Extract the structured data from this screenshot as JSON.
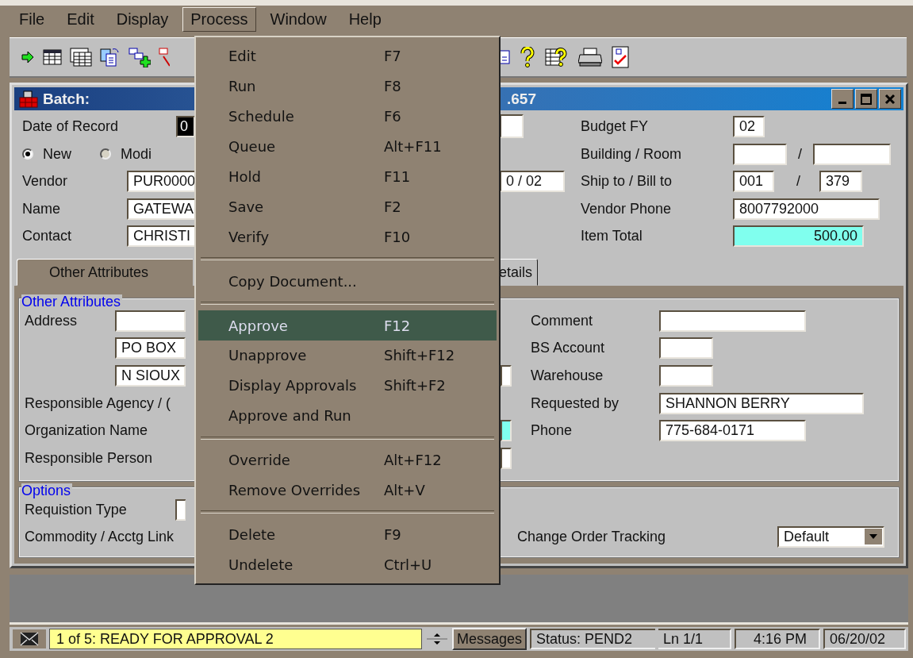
{
  "menu_bar": [
    {
      "label": "File",
      "selected": false
    },
    {
      "label": "Edit",
      "selected": false
    },
    {
      "label": "Display",
      "selected": false
    },
    {
      "label": "Process",
      "selected": true
    },
    {
      "label": "Window",
      "selected": false
    },
    {
      "label": "Help",
      "selected": false
    }
  ],
  "process_menu": {
    "sections": [
      {
        "items": [
          {
            "label": "Edit",
            "shortcut": "F7",
            "selected": false
          },
          {
            "label": "Run",
            "shortcut": "F8",
            "selected": false
          },
          {
            "label": "Schedule",
            "shortcut": "F6",
            "selected": false
          },
          {
            "label": "Queue",
            "shortcut": "Alt+F11",
            "selected": false
          },
          {
            "label": "Hold",
            "shortcut": "F11",
            "selected": false
          },
          {
            "label": "Save",
            "shortcut": "F2",
            "selected": false
          },
          {
            "label": "Verify",
            "shortcut": "F10",
            "selected": false
          }
        ]
      },
      {
        "items": [
          {
            "label": "Copy Document...",
            "selected": false
          }
        ]
      },
      {
        "items": [
          {
            "label": "Approve",
            "shortcut": "F12",
            "selected": true
          },
          {
            "label": "Unapprove",
            "shortcut": "Shift+F12",
            "selected": false
          },
          {
            "label": "Display Approvals",
            "shortcut": "Shift+F2",
            "selected": false
          },
          {
            "label": "Approve and Run",
            "selected": false
          }
        ]
      },
      {
        "items": [
          {
            "label": "Override",
            "shortcut": "Alt+F12",
            "selected": false
          },
          {
            "label": "Remove Overrides",
            "shortcut": "Alt+V",
            "selected": false
          }
        ]
      },
      {
        "items": [
          {
            "label": "Delete",
            "shortcut": "F9",
            "selected": false
          },
          {
            "label": "Undelete",
            "shortcut": "Ctrl+U",
            "selected": false
          }
        ]
      }
    ]
  },
  "window": {
    "title": "Batch:",
    "title_tail": ".657"
  },
  "header": {
    "date_of_record": {
      "label": "Date of Record",
      "value": "0"
    },
    "radios": [
      {
        "label": "New",
        "selected": true
      },
      {
        "label": "Modi",
        "selected": false
      }
    ],
    "left_fields": [
      {
        "label": "Vendor",
        "value": "PUR0000"
      },
      {
        "label": "Name",
        "value": "GATEWA"
      },
      {
        "label": "Contact",
        "value": "CHRISTI"
      }
    ],
    "middle_value": "0  / 02",
    "right_fields": [
      {
        "label": "Budget FY",
        "kind": "single",
        "values": [
          "02"
        ]
      },
      {
        "label": "Building / Room",
        "kind": "pair",
        "separator": "/"
      },
      {
        "label": "Ship to / Bill to",
        "kind": "pair",
        "separator": "/",
        "values": [
          "001",
          "379"
        ]
      },
      {
        "label": "Vendor Phone",
        "kind": "single",
        "values": [
          "8007792000"
        ]
      },
      {
        "label": "Item Total",
        "kind": "computed",
        "values": [
          "500.00"
        ]
      }
    ]
  },
  "tabs": [
    {
      "label": "Other Attributes",
      "selected": true
    },
    {
      "label": "etails",
      "selected": false
    }
  ],
  "other_attributes": {
    "title": "Other Attributes",
    "address": {
      "label": "Address",
      "lines": [
        "PO BOX",
        "N SIOUX"
      ]
    },
    "left_labels": [
      "Responsible Agency / (",
      "Organization Name",
      "Responsible Person"
    ],
    "right_fields": [
      {
        "label": "Comment"
      },
      {
        "label": "BS Account"
      },
      {
        "label": "Warehouse"
      },
      {
        "label": "Requested by",
        "value": "SHANNON BERRY"
      },
      {
        "label": "Phone",
        "value": "775-684-0171"
      }
    ]
  },
  "options": {
    "title": "Options",
    "left_labels": [
      "Requistion Type",
      "Commodity / Acctg Link"
    ],
    "change_order": {
      "label": "Change Order Tracking",
      "value": "Default"
    }
  },
  "status_bar": {
    "message": "1 of 5: READY FOR APPROVAL 2",
    "messages_button": "Messages",
    "status": "Status: PEND2",
    "line": "Ln 1/1",
    "time": "4:16 PM",
    "date": "06/20/02"
  }
}
